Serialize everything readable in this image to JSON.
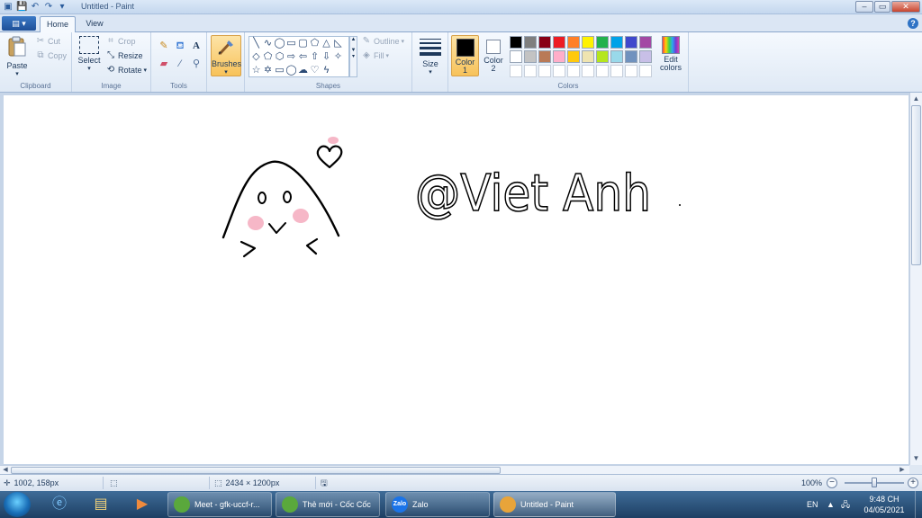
{
  "window": {
    "title": "Untitled - Paint",
    "controls": {
      "minimize": "–",
      "maximize": "▭",
      "close": "✕"
    }
  },
  "tabs": {
    "app_menu": "▤ ▾",
    "home": "Home",
    "view": "View",
    "help": "?"
  },
  "ribbon": {
    "clipboard": {
      "paste": "Paste",
      "cut": "Cut",
      "copy": "Copy",
      "label": "Clipboard"
    },
    "image": {
      "select": "Select",
      "crop": "Crop",
      "resize": "Resize",
      "rotate": "Rotate",
      "label": "Image"
    },
    "tools": {
      "label": "Tools"
    },
    "brushes": {
      "label_btn": "Brushes"
    },
    "shapes": {
      "outline": "Outline",
      "fill": "Fill",
      "label": "Shapes"
    },
    "size": {
      "label": "Size"
    },
    "colors": {
      "color1": "Color\n1",
      "color1_value": "#000000",
      "color2": "Color\n2",
      "color2_value": "#ffffff",
      "edit": "Edit\ncolors",
      "label": "Colors",
      "row1": [
        "#000000",
        "#7f7f7f",
        "#880015",
        "#ed1c24",
        "#ff7f27",
        "#fff200",
        "#22b14c",
        "#00a2e8",
        "#3f48cc",
        "#a349a4"
      ],
      "row2": [
        "#ffffff",
        "#c3c3c3",
        "#b97a57",
        "#ffaec9",
        "#ffc90e",
        "#efe4b0",
        "#b5e61d",
        "#99d9ea",
        "#7092be",
        "#c8bfe7"
      ]
    }
  },
  "canvas": {
    "handwriting": "@Viet Anh"
  },
  "status": {
    "cursor_pos": "1002, 158px",
    "canvas_size": "2434 × 1200px",
    "zoom": "100%",
    "zoom_fraction": 0.5
  },
  "taskbar": {
    "tasks": [
      {
        "label": "Meet - gfk-uccf-r...",
        "color": "#5aa83c"
      },
      {
        "label": "Thẻ mới - Cốc Cốc",
        "color": "#5aa83c"
      },
      {
        "label": "Zalo",
        "color": "#1b74e8",
        "badge": "Zalo"
      },
      {
        "label": "Untitled - Paint",
        "color": "#e8a43a"
      }
    ],
    "lang": "EN",
    "time": "9:48 CH",
    "date": "04/05/2021"
  }
}
